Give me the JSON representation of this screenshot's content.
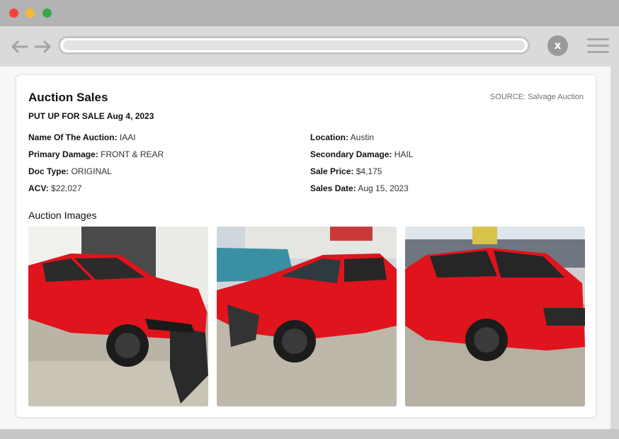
{
  "browser": {
    "back_icon": "arrow-left-icon",
    "forward_icon": "arrow-right-icon",
    "close_label": "x",
    "menu_icon": "hamburger-menu-icon"
  },
  "card": {
    "title": "Auction Sales",
    "source": "SOURCE: Salvage Auction",
    "sale_label": "PUT UP FOR SALE",
    "sale_date": "Aug 4, 2023",
    "fields": [
      {
        "label": "Name Of The Auction:",
        "value": "IAAI"
      },
      {
        "label": "Location:",
        "value": "Austin"
      },
      {
        "label": "Primary Damage:",
        "value": "FRONT & REAR"
      },
      {
        "label": "Secondary Damage:",
        "value": "HAIL"
      },
      {
        "label": "Doc Type:",
        "value": "ORIGINAL"
      },
      {
        "label": "Sale Price:",
        "value": "$4,175"
      },
      {
        "label": "ACV:",
        "value": "$22,027"
      },
      {
        "label": "Sales Date:",
        "value": "Aug 15, 2023"
      }
    ],
    "images_title": "Auction Images",
    "car_color": "#e0141c"
  }
}
